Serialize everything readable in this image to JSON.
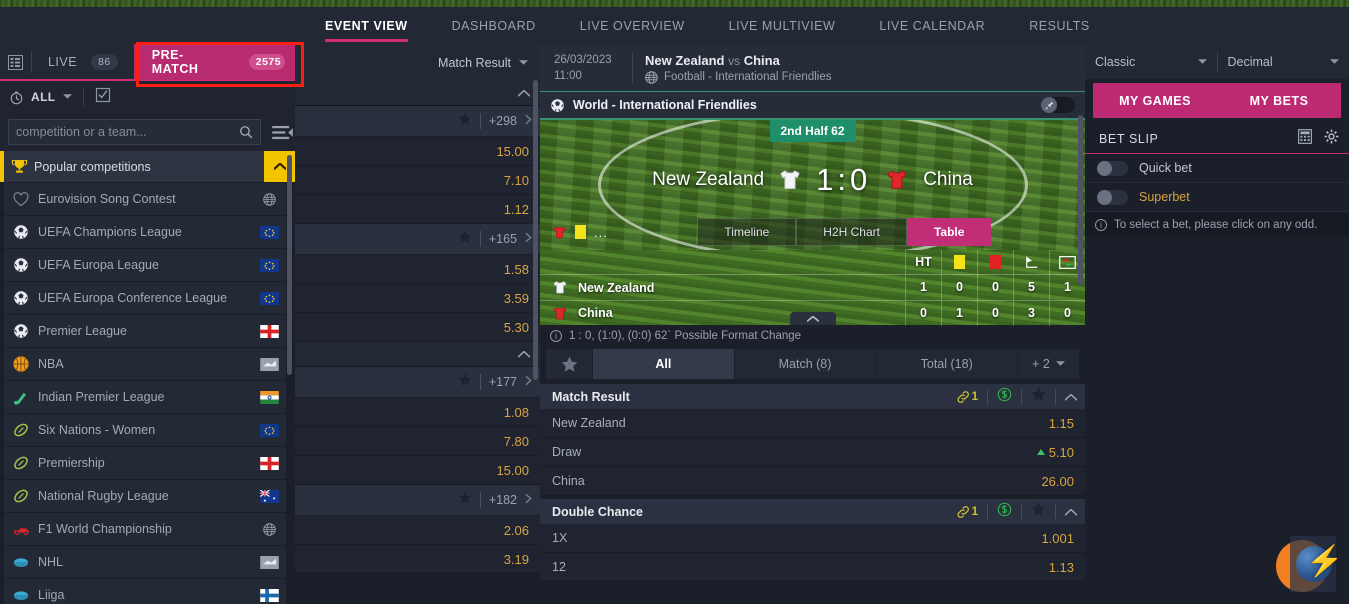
{
  "topnav": {
    "tabs": [
      {
        "label": "EVENT VIEW",
        "active": true
      },
      {
        "label": "DASHBOARD",
        "active": false
      },
      {
        "label": "LIVE OVERVIEW",
        "active": false
      },
      {
        "label": "LIVE MULTIVIEW",
        "active": false
      },
      {
        "label": "LIVE CALENDAR",
        "active": false
      },
      {
        "label": "RESULTS",
        "active": false
      }
    ]
  },
  "mode_bar": {
    "live_label": "LIVE",
    "live_count": "86",
    "prematch_label": "PRE-MATCH",
    "prematch_count": "2575",
    "highlight_color": "#fd1d13",
    "active_color": "#b82b70"
  },
  "filter_bar": {
    "all_label": "ALL"
  },
  "search": {
    "placeholder": "competition or a team...",
    "value": ""
  },
  "sidebar": {
    "header": {
      "label": "Popular competitions",
      "accent": "#f2c400"
    },
    "items": [
      {
        "label": "Eurovision Song Contest",
        "icon": "heart-icon",
        "flag": "globe"
      },
      {
        "label": "UEFA Champions League",
        "icon": "football-icon",
        "flag": "eu"
      },
      {
        "label": "UEFA Europa League",
        "icon": "football-icon",
        "flag": "eu"
      },
      {
        "label": "UEFA Europa Conference League",
        "icon": "football-icon",
        "flag": "eu"
      },
      {
        "label": "Premier League",
        "icon": "football-icon",
        "flag": "england"
      },
      {
        "label": "NBA",
        "icon": "basketball-icon",
        "flag": "usa"
      },
      {
        "label": "Indian Premier League",
        "icon": "cricket-icon",
        "flag": "india"
      },
      {
        "label": "Six Nations - Women",
        "icon": "rugby-icon",
        "flag": "eu"
      },
      {
        "label": "Premiership",
        "icon": "rugby-icon",
        "flag": "england"
      },
      {
        "label": "National Rugby League",
        "icon": "rugby-icon",
        "flag": "australia"
      },
      {
        "label": "F1 World Championship",
        "icon": "formula1-icon",
        "flag": "globe"
      },
      {
        "label": "NHL",
        "icon": "hockey-icon",
        "flag": "usa"
      },
      {
        "label": "Liiga",
        "icon": "hockey-icon",
        "flag": "finland"
      }
    ]
  },
  "odds_column": {
    "header_label": "Match Result",
    "groups": [
      {
        "event_plus": "+298",
        "odds": [
          "15.00",
          "7.10",
          "1.12"
        ]
      },
      {
        "event_plus": "+165",
        "odds": [
          "1.58",
          "3.59",
          "5.30"
        ]
      }
    ],
    "groups2": [
      {
        "event_plus": "+177",
        "odds": [
          "1.08",
          "7.80",
          "15.00"
        ]
      },
      {
        "event_plus": "+182",
        "odds": [
          "2.06",
          "3.19"
        ]
      }
    ]
  },
  "match_header": {
    "date": "26/03/2023",
    "time": "11:00",
    "home": "New Zealand",
    "vs": "vs",
    "away": "China",
    "competition": "Football - International Friendlies"
  },
  "scoreboard": {
    "title": "World - International Friendlies",
    "period": "2nd Half 62",
    "home_team": "New Zealand",
    "away_team": "China",
    "home_score": "1",
    "away_score": "0",
    "score_separator": ":",
    "view_tabs": [
      {
        "label": "Timeline",
        "active": false
      },
      {
        "label": "H2H Chart",
        "active": false
      },
      {
        "label": "Table",
        "active": true
      }
    ],
    "stats_columns": [
      "HT",
      "yellow-card",
      "red-card",
      "corner",
      "substitution"
    ],
    "stats_header_labels": [
      "HT",
      "",
      "",
      "",
      ""
    ],
    "stats_rows": [
      {
        "team": "New Zealand",
        "values": [
          "1",
          "0",
          "0",
          "5",
          "1"
        ]
      },
      {
        "team": "China",
        "values": [
          "0",
          "1",
          "0",
          "3",
          "0"
        ]
      }
    ],
    "info_text": "1 : 0, (1:0), (0:0) 62` Possible Format Change"
  },
  "market_tabs": [
    {
      "label": "All",
      "active": true
    },
    {
      "label": "Match (8)",
      "active": false
    },
    {
      "label": "Total (18)",
      "active": false
    }
  ],
  "market_more": "+ 2",
  "markets": [
    {
      "name": "Match Result",
      "link_count": "1",
      "selections": [
        {
          "name": "New Zealand",
          "odd": "1.15",
          "trend": ""
        },
        {
          "name": "Draw",
          "odd": "5.10",
          "trend": "up"
        },
        {
          "name": "China",
          "odd": "26.00",
          "trend": ""
        }
      ]
    },
    {
      "name": "Double Chance",
      "link_count": "1",
      "selections": [
        {
          "name": "1X",
          "odd": "1.001",
          "trend": ""
        },
        {
          "name": "12",
          "odd": "1.13",
          "trend": ""
        }
      ]
    }
  ],
  "right_panel": {
    "view_select": "Classic",
    "odds_format_select": "Decimal",
    "tabs": [
      {
        "label": "MY GAMES",
        "active": true
      },
      {
        "label": "MY BETS",
        "active": false
      }
    ],
    "betslip_title": "BET SLIP",
    "toggles": [
      {
        "label": "Quick bet",
        "on": false
      },
      {
        "label": "Superbet",
        "on": false
      }
    ],
    "hint": "To select a bet, please click on any odd."
  }
}
